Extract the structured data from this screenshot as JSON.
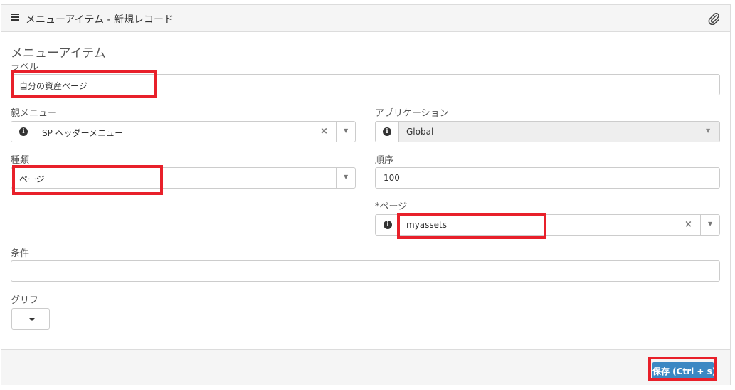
{
  "header": {
    "title": "メニューアイテム - 新規レコード",
    "menu_icon": "hamburger-icon",
    "attach_icon": "paperclip-icon"
  },
  "section_title": "メニューアイテム",
  "fields": {
    "label": {
      "label": "ラベル",
      "value": "自分の資産ページ"
    },
    "parent_menu": {
      "label": "親メニュー",
      "value": "SP ヘッダーメニュー"
    },
    "application": {
      "label": "アプリケーション",
      "value": "Global"
    },
    "type": {
      "label": "種類",
      "value": "ページ"
    },
    "order": {
      "label": "順序",
      "value": "100"
    },
    "page": {
      "label": "*ページ",
      "value": "myassets"
    },
    "condition": {
      "label": "条件",
      "value": ""
    },
    "glyph": {
      "label": "グリフ"
    }
  },
  "footer": {
    "save_label": "保存 (Ctrl + s)"
  },
  "colors": {
    "highlight": "#e8202a",
    "primary": "#3b88c3",
    "header_bg": "#f5f5f5"
  }
}
